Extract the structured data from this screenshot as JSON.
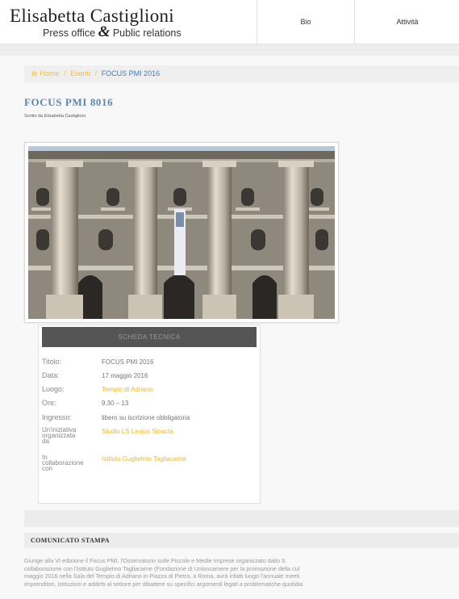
{
  "header": {
    "logo_main": "Elisabetta Castiglioni",
    "logo_sub_left": "Press office",
    "logo_amp": "&",
    "logo_sub_right": "Public relations",
    "nav": [
      "Bio",
      "Attività"
    ]
  },
  "breadcrumb": {
    "home": "Home",
    "sep1": "/",
    "eventi": "Eventi",
    "sep2": "/",
    "current": "FOCUS PMI 2016"
  },
  "post": {
    "title": "FOCUS PMI 8016",
    "byline": "Scritto da Elisabetta Castiglioni"
  },
  "scheda": {
    "header": "SCHEDA TECNICA",
    "rows": [
      {
        "label": "Titolo:",
        "value": "FOCUS PMI 2016"
      },
      {
        "label": "Data:",
        "value": "17 maggio 2016"
      },
      {
        "label": "Luogo:",
        "value": "Tempio di Adriano"
      },
      {
        "label": "Ore:",
        "value": "9.30 – 13"
      },
      {
        "label": "Ingresso:",
        "value": "libero su iscrizione obbligatoria"
      },
      {
        "label": "Un'iniziativa organizzata da",
        "value": "Studio LS Lexjus Sinacta"
      },
      {
        "label": "In collaborazione con",
        "value": "Istituto Guglielmo Tagliacarne"
      }
    ]
  },
  "comunicato": {
    "title": "COMUNICATO STAMPA",
    "lines": [
      "Giunge alla VI edizione il Focus PMI, l'Osservatorio sulle Piccole e Medie Imprese organizzato dallo S",
      "collaborazione con l'Istituto Guglielmo Tagliacarne (Fondazione di Unioncamere per la promozione della cul",
      "maggio 2016 nella Sala del Tempio di Adriano in Piazza di Pietra, a Roma, avrà infatti luogo l'annuale meeti",
      "imprenditori, istituzioni e addetti al settore per dibattere su specifici argomenti legati a problematiche quotidia"
    ]
  },
  "colors": {
    "accent_link": "#f0c040",
    "title_blue": "#5b86b0",
    "scheda_header_bg": "#555555"
  }
}
